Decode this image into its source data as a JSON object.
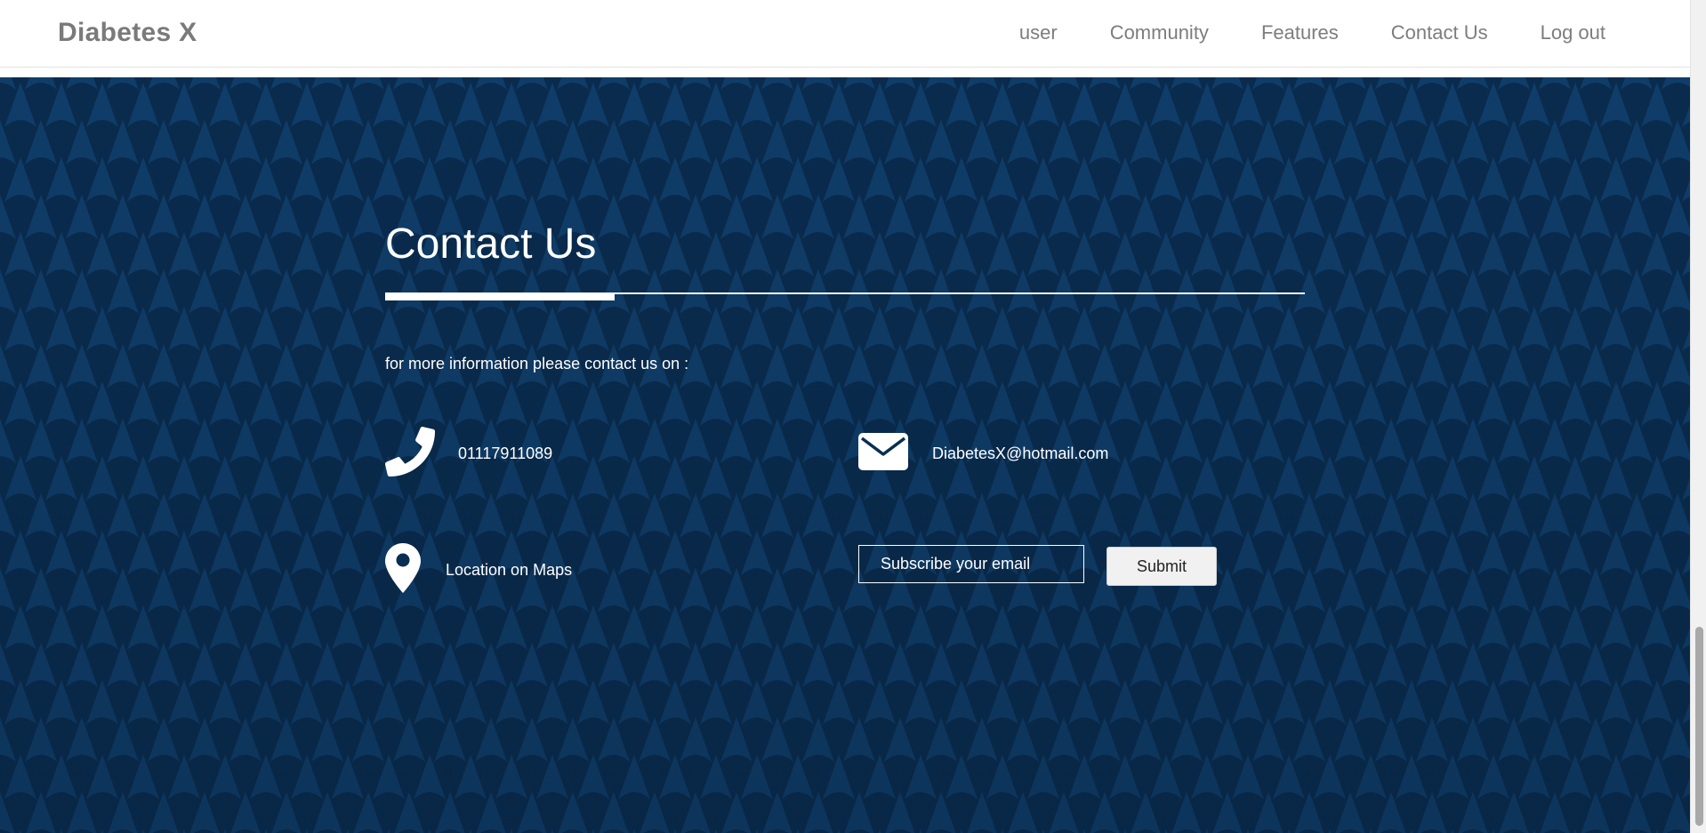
{
  "brand": "Diabetes X",
  "nav": [
    {
      "label": "user"
    },
    {
      "label": "Community"
    },
    {
      "label": "Features"
    },
    {
      "label": "Contact Us"
    },
    {
      "label": "Log out"
    }
  ],
  "contact": {
    "title": "Contact Us",
    "intro": "for more information please contact us on :",
    "phone": {
      "icon": "phone-icon",
      "text": "01117911089"
    },
    "email": {
      "icon": "envelope-icon",
      "text": "DiabetesX@hotmail.com"
    },
    "location": {
      "icon": "map-marker-icon",
      "text": "Location on Maps"
    },
    "subscribe": {
      "placeholder": "Subscribe your email",
      "button": "Submit"
    }
  },
  "colors": {
    "background": "#0a2e52",
    "pattern": "#12497c",
    "text": "#ffffff",
    "nav_text": "#7d7d7d"
  }
}
